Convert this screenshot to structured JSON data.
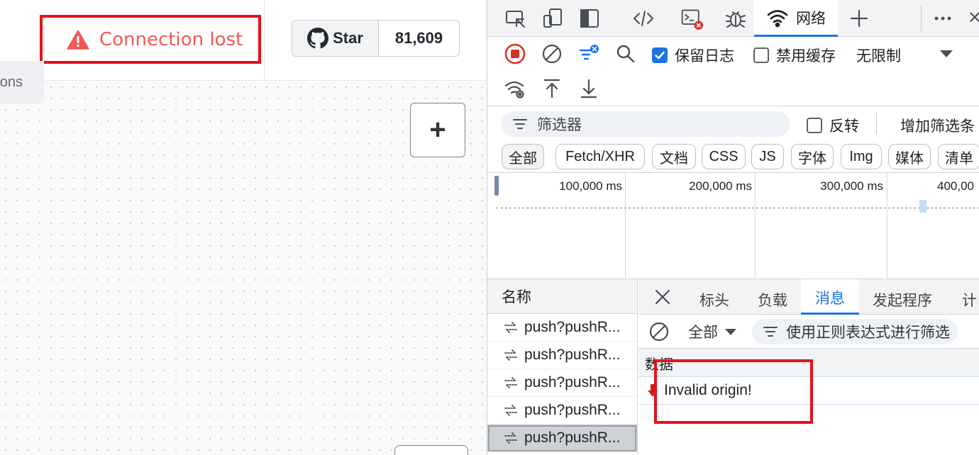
{
  "app": {
    "connection_status": "Connection lost",
    "side_tab_label": "ons",
    "github": {
      "star_label": "Star",
      "star_count": "81,609"
    },
    "add_button_label": "+"
  },
  "devtools": {
    "active_tab": "网络",
    "toolbar": {
      "preserve_log": "保留日志",
      "disable_cache": "禁用缓存",
      "throttling": "无限制"
    },
    "filter": {
      "placeholder": "筛选器",
      "invert": "反转",
      "more_filters": "增加筛选条"
    },
    "type_filters": [
      "全部",
      "Fetch/XHR",
      "文档",
      "CSS",
      "JS",
      "字体",
      "Img",
      "媒体",
      "清单"
    ],
    "timeline_labels": [
      "100,000 ms",
      "200,000 ms",
      "300,000 ms",
      "400,00"
    ],
    "request_list": {
      "header": "名称",
      "rows": [
        "push?pushR...",
        "push?pushR...",
        "push?pushR...",
        "push?pushR...",
        "push?pushR..."
      ]
    },
    "detail_tabs": [
      "标头",
      "负载",
      "消息",
      "发起程序",
      "计"
    ],
    "messages": {
      "type_select": "全部",
      "filter_placeholder": "使用正则表达式进行筛选",
      "column_header": "数据",
      "rows": [
        "Invalid origin!"
      ]
    }
  },
  "colors": {
    "highlight_red": "#e8101b",
    "accent_blue": "#1a73e8",
    "warning_red": "#f05a52"
  }
}
